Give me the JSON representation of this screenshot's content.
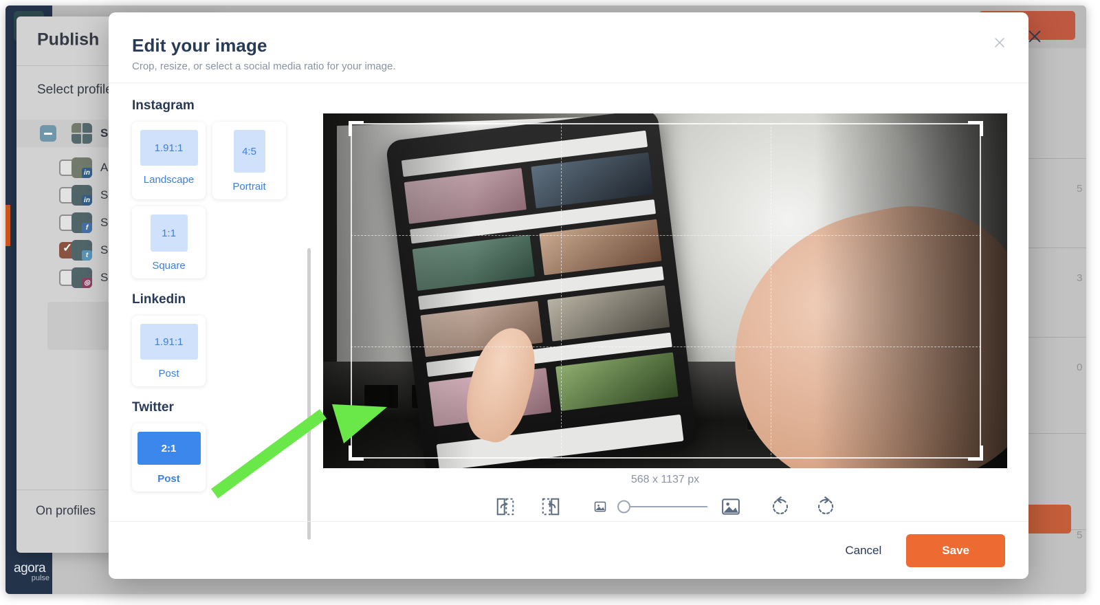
{
  "background": {
    "app_name": "agorapulse",
    "logo_line1": "agora",
    "logo_line2": "pulse",
    "publish": {
      "title": "Publish",
      "section_label": "Select profile",
      "profiles": [
        {
          "name": "Som",
          "state": "indeterminate",
          "network": "all"
        },
        {
          "name": "Ann",
          "state": "unchecked",
          "network": "linkedin"
        },
        {
          "name": "Som",
          "state": "unchecked",
          "network": "linkedin"
        },
        {
          "name": "Som",
          "state": "unchecked",
          "network": "facebook"
        },
        {
          "name": "Som",
          "state": "checked",
          "network": "twitter"
        },
        {
          "name": "Som",
          "state": "unchecked",
          "network": "instagram"
        }
      ],
      "footer_label": "On profiles"
    },
    "list_chars": [
      "5",
      "3",
      "0",
      "5"
    ]
  },
  "modal": {
    "title": "Edit your image",
    "subtitle": "Crop, resize, or select a social media ratio for your image.",
    "close_icon": "close-icon",
    "groups": [
      {
        "name": "Instagram",
        "cards": [
          {
            "ratio": "1.91:1",
            "label": "Landscape",
            "shape": "box-191",
            "selected": false
          },
          {
            "ratio": "4:5",
            "label": "Portrait",
            "shape": "box-45",
            "selected": false
          },
          {
            "ratio": "1:1",
            "label": "Square",
            "shape": "box-11",
            "selected": false
          }
        ]
      },
      {
        "name": "Linkedin",
        "cards": [
          {
            "ratio": "1.91:1",
            "label": "Post",
            "shape": "box-191",
            "selected": false
          }
        ]
      },
      {
        "name": "Twitter",
        "cards": [
          {
            "ratio": "2:1",
            "label": "Post",
            "shape": "box-21",
            "selected": true
          }
        ]
      }
    ],
    "editor": {
      "dimensions": "568 x 1137 px",
      "tools": [
        {
          "name": "flip-horizontal-icon",
          "label": "Flip horizontal"
        },
        {
          "name": "flip-vertical-icon",
          "label": "Flip vertical"
        },
        {
          "name": "zoom-out-image-icon",
          "label": "Zoom out"
        },
        {
          "name": "zoom-slider",
          "label": "Zoom",
          "value": 0
        },
        {
          "name": "zoom-in-image-icon",
          "label": "Zoom in"
        },
        {
          "name": "rotate-left-icon",
          "label": "Rotate left"
        },
        {
          "name": "rotate-right-icon",
          "label": "Rotate right"
        }
      ]
    },
    "footer": {
      "cancel_label": "Cancel",
      "save_label": "Save"
    }
  },
  "colors": {
    "accent_orange": "#ed6b33",
    "accent_blue": "#3b87ec",
    "ratio_blue_light": "#cfe1fb",
    "text_dark": "#283a55",
    "text_muted": "#8a93a4",
    "annotation_green": "#6ae84a"
  }
}
